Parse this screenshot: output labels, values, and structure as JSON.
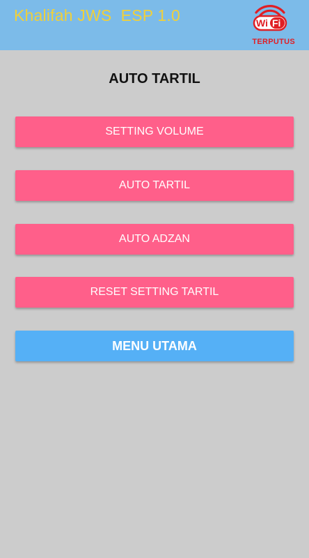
{
  "header": {
    "app_title": "Khalifah JWS  ESP 1.0",
    "wifi_logo_text": {
      "w": "Wi",
      "f": "Fi"
    },
    "wifi_status": "TERPUTUS"
  },
  "page": {
    "title": "AUTO TARTIL"
  },
  "buttons": [
    {
      "label": "SETTING VOLUME",
      "color": "#ff5f8a"
    },
    {
      "label": "AUTO TARTIL",
      "color": "#ff5f8a"
    },
    {
      "label": "AUTO ADZAN",
      "color": "#ff5f8a"
    },
    {
      "label": "RESET SETTING TARTIL",
      "color": "#ff5f8a"
    },
    {
      "label": "MENU UTAMA",
      "color": "#55b0f6"
    }
  ],
  "colors": {
    "header_bg": "#7cbbe9",
    "title_text": "#f0d03a",
    "status_text": "#e01e24",
    "page_bg": "#cccccc"
  },
  "icons": {
    "wifi_logo": "wifi-logo-icon"
  }
}
